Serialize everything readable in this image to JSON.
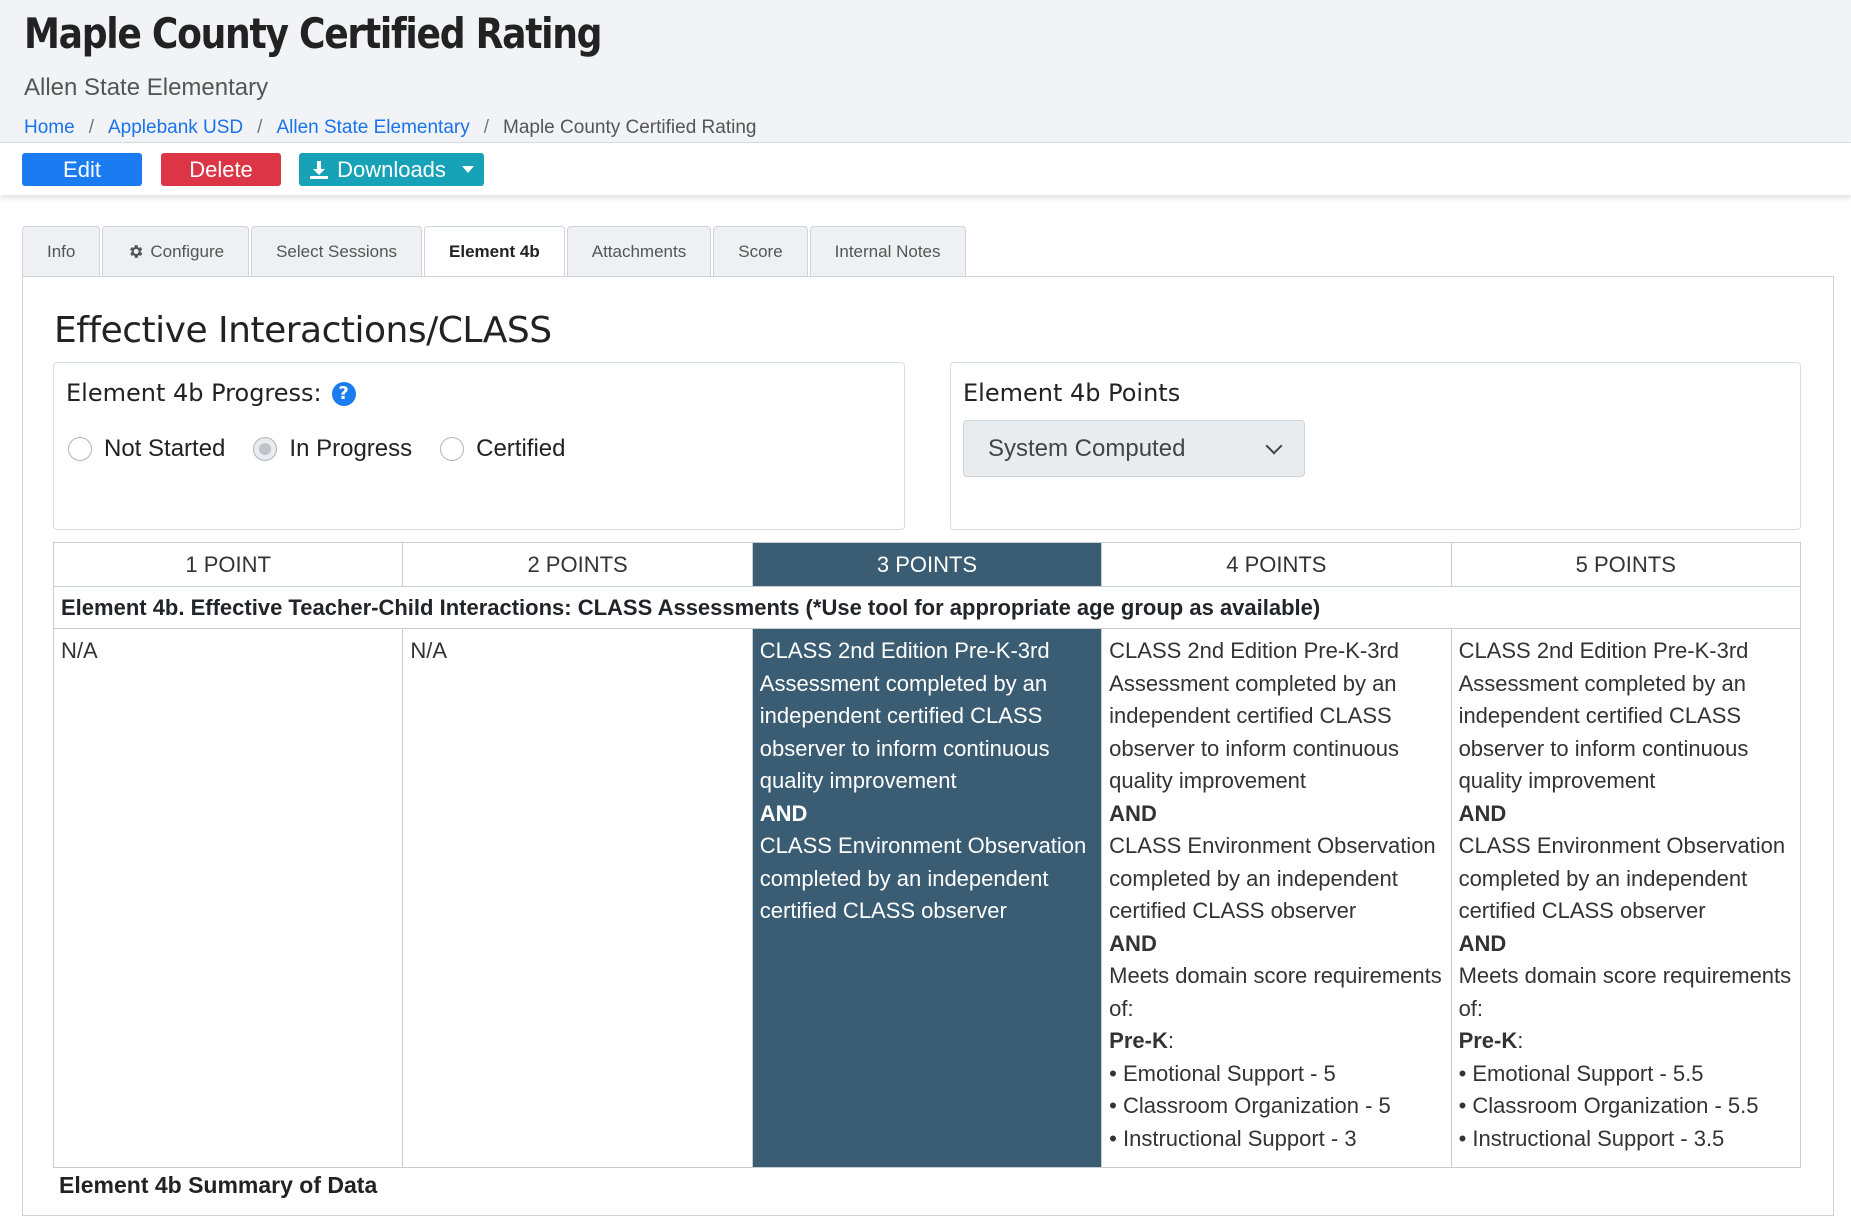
{
  "header": {
    "title": "Maple County Certified Rating",
    "subtitle": "Allen State Elementary",
    "breadcrumb": [
      "Home",
      "Applebank USD",
      "Allen State Elementary"
    ],
    "breadcrumb_current": "Maple County Certified Rating"
  },
  "toolbar": {
    "edit_label": "Edit",
    "delete_label": "Delete",
    "downloads_label": "Downloads",
    "colors": {
      "edit": "#1a7cf0",
      "delete": "#dc3545",
      "downloads": "#17a2b8"
    }
  },
  "tabs": [
    {
      "label": "Info",
      "icon": ""
    },
    {
      "label": "Configure",
      "icon": "gear-icon"
    },
    {
      "label": "Select Sessions",
      "icon": ""
    },
    {
      "label": "Element 4b",
      "icon": "",
      "active": true
    },
    {
      "label": "Attachments",
      "icon": ""
    },
    {
      "label": "Score",
      "icon": ""
    },
    {
      "label": "Internal Notes",
      "icon": ""
    }
  ],
  "section": {
    "title": "Effective Interactions/CLASS"
  },
  "progress": {
    "label": "Element 4b Progress:",
    "help_icon": "question-circle-icon",
    "options": [
      "Not Started",
      "In Progress",
      "Certified"
    ],
    "selected": "In Progress"
  },
  "points": {
    "label": "Element 4b Points",
    "selected": "System Computed"
  },
  "rubric": {
    "headers": [
      "1 POINT",
      "2 POINTS",
      "3 POINTS",
      "4 POINTS",
      "5 POINTS"
    ],
    "highlighted_index": 2,
    "highlight_color": "#3b5d73",
    "criterion": "Element 4b. Effective Teacher-Child Interactions: CLASS Assessments (*Use tool for appropriate age group as available)",
    "cells": [
      {
        "text": "N/A"
      },
      {
        "text": "N/A"
      },
      {
        "line1": "CLASS 2nd Edition Pre-K-3rd Assessment completed by an independent certified CLASS observer to inform continuous quality improvement",
        "and1": "AND",
        "line2": "CLASS Environment Observation completed by an independent certified CLASS observer"
      },
      {
        "line1": "CLASS 2nd Edition Pre-K-3rd Assessment completed by an independent certified CLASS observer to inform continuous quality improvement",
        "and1": "AND",
        "line2": "CLASS Environment Observation completed by an independent certified CLASS observer",
        "and2": "AND",
        "line3": "Meets domain score requirements of:",
        "prek_label": "Pre-K",
        "bullets": [
          "• Emotional Support - 5",
          "• Classroom Organization - 5",
          "• Instructional Support - 3"
        ]
      },
      {
        "line1": "CLASS 2nd Edition Pre-K-3rd Assessment completed by an independent certified CLASS observer to inform continuous quality improvement",
        "and1": "AND",
        "line2": "CLASS Environment Observation completed by an independent certified CLASS observer",
        "and2": "AND",
        "line3": "Meets domain score requirements of:",
        "prek_label": "Pre-K",
        "bullets": [
          "• Emotional Support - 5.5",
          "• Classroom Organization - 5.5",
          "• Instructional Support - 3.5"
        ]
      }
    ]
  },
  "summary": {
    "title": "Element 4b Summary of Data"
  }
}
